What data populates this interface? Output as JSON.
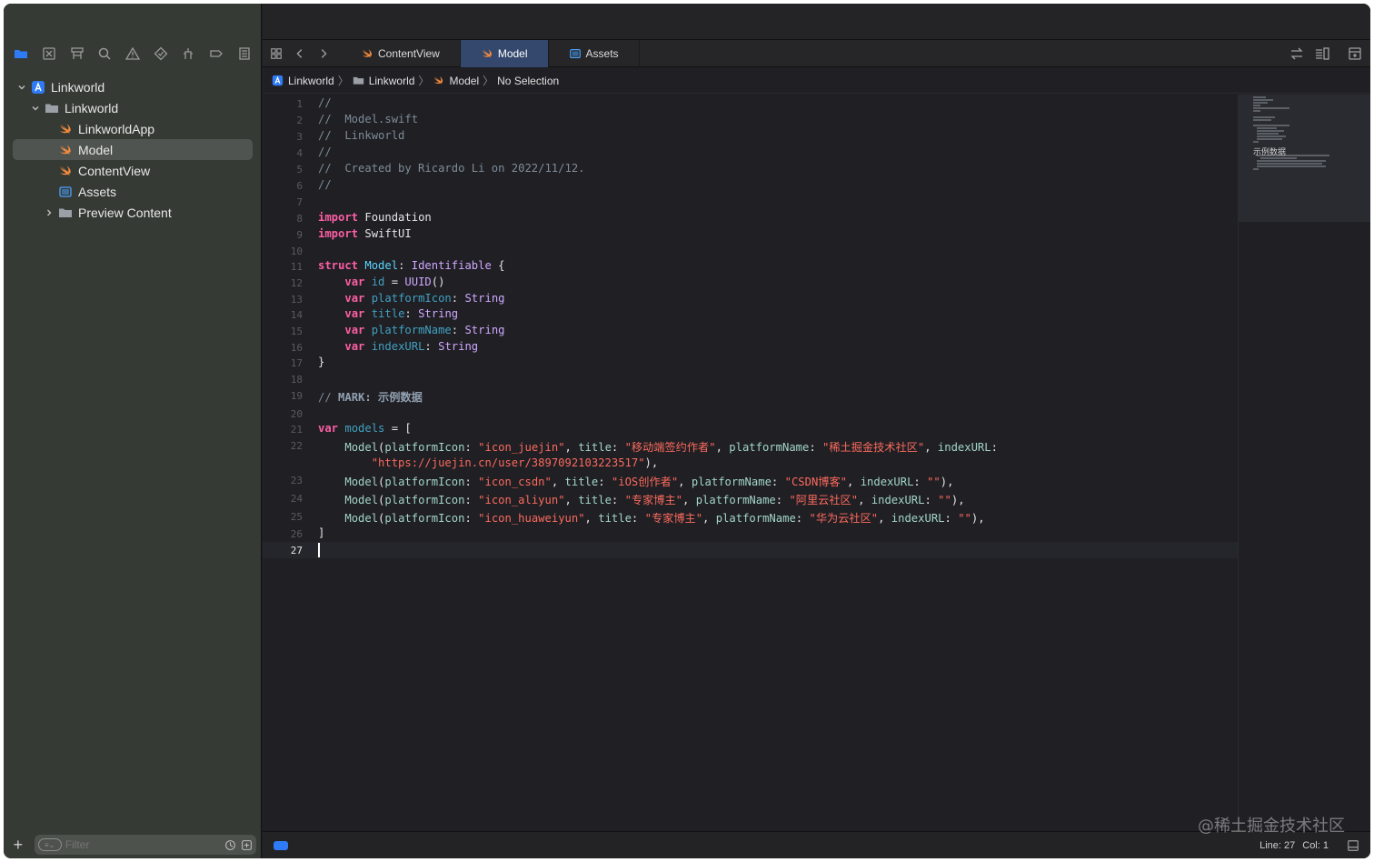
{
  "sidebar": {
    "toolbar_icons": [
      "folder-icon",
      "source-control-icon",
      "symbol-icon",
      "search-icon",
      "warning-icon",
      "test-icon",
      "debug-icon",
      "breakpoint-icon",
      "report-icon"
    ],
    "tree": [
      {
        "label": "Linkworld",
        "icon": "project-icon",
        "disclosure": "open",
        "level": 0
      },
      {
        "label": "Linkworld",
        "icon": "folder-icon",
        "disclosure": "open",
        "level": 1
      },
      {
        "label": "LinkworldApp",
        "icon": "swift-icon",
        "disclosure": "none",
        "level": 2
      },
      {
        "label": "Model",
        "icon": "swift-icon",
        "disclosure": "none",
        "level": 2,
        "selected": true
      },
      {
        "label": "ContentView",
        "icon": "swift-icon",
        "disclosure": "none",
        "level": 2
      },
      {
        "label": "Assets",
        "icon": "assets-icon",
        "disclosure": "none",
        "level": 2
      },
      {
        "label": "Preview Content",
        "icon": "folder-icon",
        "disclosure": "closed",
        "level": 2
      }
    ],
    "filter_placeholder": "Filter"
  },
  "tabs": [
    {
      "label": "ContentView",
      "icon": "swift-icon",
      "active": false
    },
    {
      "label": "Model",
      "icon": "swift-icon",
      "active": true
    },
    {
      "label": "Assets",
      "icon": "assets-icon",
      "active": false
    }
  ],
  "jumpbar": [
    {
      "label": "Linkworld",
      "icon": "project-icon"
    },
    {
      "label": "Linkworld",
      "icon": "folder-icon"
    },
    {
      "label": "Model",
      "icon": "swift-icon"
    },
    {
      "label": "No Selection",
      "icon": ""
    }
  ],
  "code": {
    "current_line": 27,
    "lines": [
      [
        [
          "cm",
          "//"
        ]
      ],
      [
        [
          "cm",
          "//  Model.swift"
        ]
      ],
      [
        [
          "cm",
          "//  Linkworld"
        ]
      ],
      [
        [
          "cm",
          "//"
        ]
      ],
      [
        [
          "cm",
          "//  Created by Ricardo Li on 2022/11/12."
        ]
      ],
      [
        [
          "cm",
          "//"
        ]
      ],
      [],
      [
        [
          "kw",
          "import"
        ],
        [
          "tx",
          " Foundation"
        ]
      ],
      [
        [
          "kw",
          "import"
        ],
        [
          "tx",
          " SwiftUI"
        ]
      ],
      [],
      [
        [
          "kw",
          "struct"
        ],
        [
          "tx",
          " "
        ],
        [
          "tyd",
          "Model"
        ],
        [
          "tx",
          ": "
        ],
        [
          "ty",
          "Identifiable"
        ],
        [
          "tx",
          " {"
        ]
      ],
      [
        [
          "tx",
          "    "
        ],
        [
          "kw",
          "var"
        ],
        [
          "tx",
          " "
        ],
        [
          "id",
          "id"
        ],
        [
          "tx",
          " = "
        ],
        [
          "ty",
          "UUID"
        ],
        [
          "tx",
          "()"
        ]
      ],
      [
        [
          "tx",
          "    "
        ],
        [
          "kw",
          "var"
        ],
        [
          "tx",
          " "
        ],
        [
          "id",
          "platformIcon"
        ],
        [
          "tx",
          ": "
        ],
        [
          "ty",
          "String"
        ]
      ],
      [
        [
          "tx",
          "    "
        ],
        [
          "kw",
          "var"
        ],
        [
          "tx",
          " "
        ],
        [
          "id",
          "title"
        ],
        [
          "tx",
          ": "
        ],
        [
          "ty",
          "String"
        ]
      ],
      [
        [
          "tx",
          "    "
        ],
        [
          "kw",
          "var"
        ],
        [
          "tx",
          " "
        ],
        [
          "id",
          "platformName"
        ],
        [
          "tx",
          ": "
        ],
        [
          "ty",
          "String"
        ]
      ],
      [
        [
          "tx",
          "    "
        ],
        [
          "kw",
          "var"
        ],
        [
          "tx",
          " "
        ],
        [
          "id",
          "indexURL"
        ],
        [
          "tx",
          ": "
        ],
        [
          "ty",
          "String"
        ]
      ],
      [
        [
          "tx",
          "}"
        ]
      ],
      [],
      [
        [
          "cm",
          "// "
        ],
        [
          "mk",
          "MARK: 示例数据"
        ]
      ],
      [],
      [
        [
          "kw",
          "var"
        ],
        [
          "tx",
          " "
        ],
        [
          "id",
          "models"
        ],
        [
          "tx",
          " = ["
        ]
      ],
      [
        [
          "tx",
          "    "
        ],
        [
          "pl",
          "Model"
        ],
        [
          "tx",
          "("
        ],
        [
          "pl",
          "platformIcon"
        ],
        [
          "tx",
          ": "
        ],
        [
          "st",
          "\"icon_juejin\""
        ],
        [
          "tx",
          ", "
        ],
        [
          "pl",
          "title"
        ],
        [
          "tx",
          ": "
        ],
        [
          "st",
          "\"移动端签约作者\""
        ],
        [
          "tx",
          ", "
        ],
        [
          "pl",
          "platformName"
        ],
        [
          "tx",
          ": "
        ],
        [
          "st",
          "\"稀土掘金技术社区\""
        ],
        [
          "tx",
          ", "
        ],
        [
          "pl",
          "indexURL"
        ],
        [
          "tx",
          ":"
        ]
      ],
      [
        [
          "tx",
          "        "
        ],
        [
          "st",
          "\"https://juejin.cn/user/3897092103223517\""
        ],
        [
          "tx",
          "),"
        ]
      ],
      [
        [
          "tx",
          "    "
        ],
        [
          "pl",
          "Model"
        ],
        [
          "tx",
          "("
        ],
        [
          "pl",
          "platformIcon"
        ],
        [
          "tx",
          ": "
        ],
        [
          "st",
          "\"icon_csdn\""
        ],
        [
          "tx",
          ", "
        ],
        [
          "pl",
          "title"
        ],
        [
          "tx",
          ": "
        ],
        [
          "st",
          "\"iOS创作者\""
        ],
        [
          "tx",
          ", "
        ],
        [
          "pl",
          "platformName"
        ],
        [
          "tx",
          ": "
        ],
        [
          "st",
          "\"CSDN博客\""
        ],
        [
          "tx",
          ", "
        ],
        [
          "pl",
          "indexURL"
        ],
        [
          "tx",
          ": "
        ],
        [
          "st",
          "\"\""
        ],
        [
          "tx",
          "),"
        ]
      ],
      [
        [
          "tx",
          "    "
        ],
        [
          "pl",
          "Model"
        ],
        [
          "tx",
          "("
        ],
        [
          "pl",
          "platformIcon"
        ],
        [
          "tx",
          ": "
        ],
        [
          "st",
          "\"icon_aliyun\""
        ],
        [
          "tx",
          ", "
        ],
        [
          "pl",
          "title"
        ],
        [
          "tx",
          ": "
        ],
        [
          "st",
          "\"专家博主\""
        ],
        [
          "tx",
          ", "
        ],
        [
          "pl",
          "platformName"
        ],
        [
          "tx",
          ": "
        ],
        [
          "st",
          "\"阿里云社区\""
        ],
        [
          "tx",
          ", "
        ],
        [
          "pl",
          "indexURL"
        ],
        [
          "tx",
          ": "
        ],
        [
          "st",
          "\"\""
        ],
        [
          "tx",
          "),"
        ]
      ],
      [
        [
          "tx",
          "    "
        ],
        [
          "pl",
          "Model"
        ],
        [
          "tx",
          "("
        ],
        [
          "pl",
          "platformIcon"
        ],
        [
          "tx",
          ": "
        ],
        [
          "st",
          "\"icon_huaweiyun\""
        ],
        [
          "tx",
          ", "
        ],
        [
          "pl",
          "title"
        ],
        [
          "tx",
          ": "
        ],
        [
          "st",
          "\"专家博主\""
        ],
        [
          "tx",
          ", "
        ],
        [
          "pl",
          "platformName"
        ],
        [
          "tx",
          ": "
        ],
        [
          "st",
          "\"华为云社区\""
        ],
        [
          "tx",
          ", "
        ],
        [
          "pl",
          "indexURL"
        ],
        [
          "tx",
          ": "
        ],
        [
          "st",
          "\"\""
        ],
        [
          "tx",
          "),"
        ]
      ],
      [
        [
          "tx",
          "]"
        ]
      ],
      []
    ],
    "line_numbers": [
      "1",
      "2",
      "3",
      "4",
      "5",
      "6",
      "7",
      "8",
      "9",
      "10",
      "11",
      "12",
      "13",
      "14",
      "15",
      "16",
      "17",
      "18",
      "19",
      "20",
      "21",
      "22",
      "",
      "23",
      "24",
      "25",
      "26",
      "27"
    ]
  },
  "minimap": {
    "mark_label": "示例数据"
  },
  "status": {
    "line_label": "Line: 27",
    "col_label": "Col: 1"
  },
  "watermark": "@稀土掘金技术社区",
  "colors": {
    "accent": "#2f7bf6",
    "keyword": "#fc5fa3",
    "string": "#fc6a5d",
    "comment": "#7f8c98",
    "selection": "#4f5450",
    "active_tab": "#34486d"
  }
}
